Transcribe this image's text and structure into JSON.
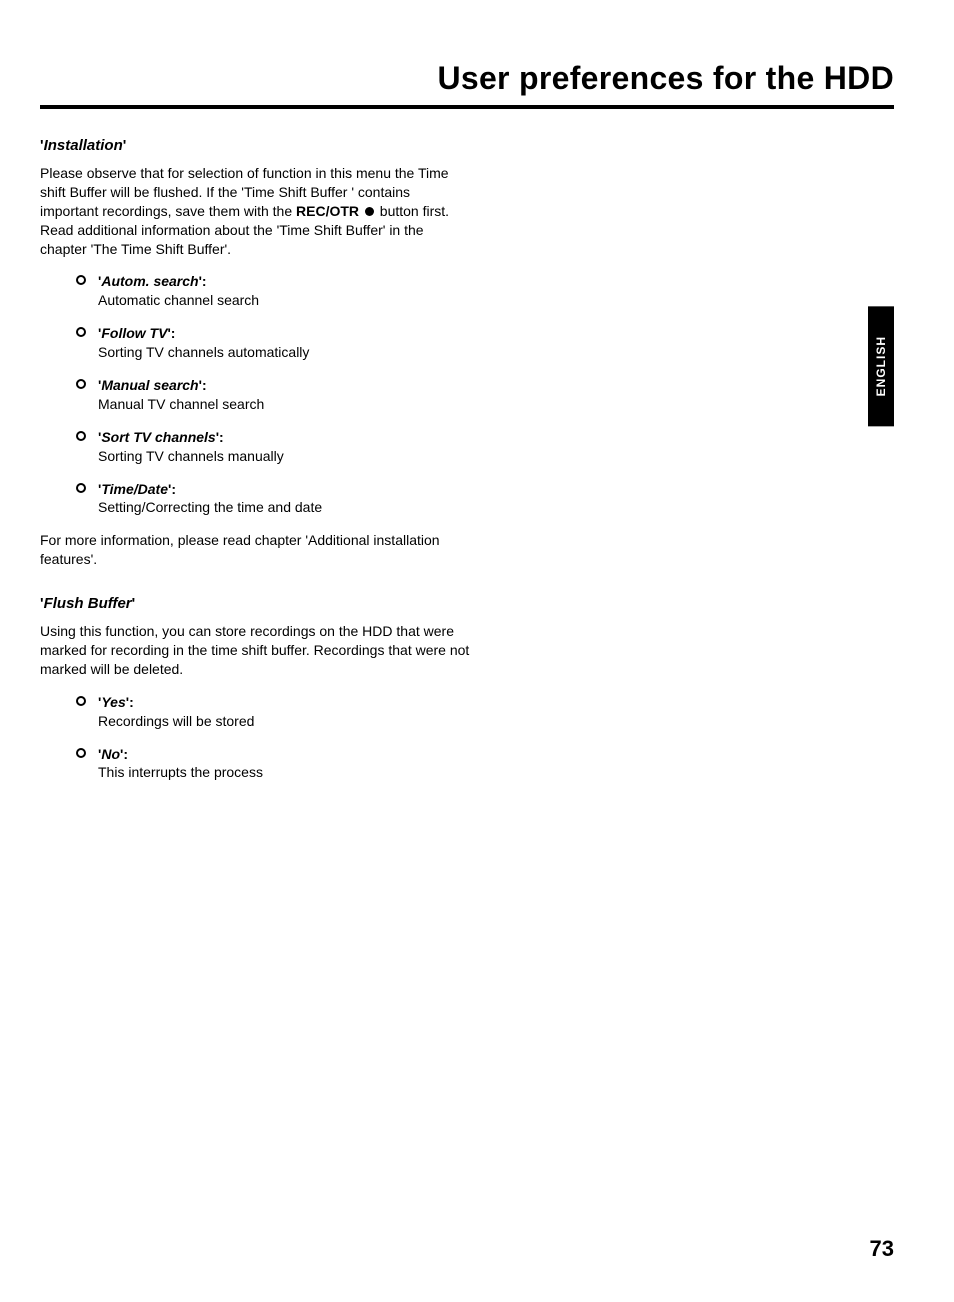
{
  "header": {
    "title": "User preferences for the HDD"
  },
  "sidebar": {
    "language": "ENGLISH"
  },
  "pageNumber": "73",
  "section1": {
    "heading_open": "'",
    "heading_name": "Installation",
    "heading_close": "'",
    "intro_pre": "Please observe that for selection of function in this menu the Time shift Buffer will be flushed. If the 'Time Shift Buffer ' contains important recordings, save them with the ",
    "intro_button": "REC/OTR",
    "intro_post": " button first. Read additional information about the 'Time Shift Buffer' in the chapter 'The Time Shift Buffer'.",
    "items": [
      {
        "label": "Autom. search",
        "desc": "Automatic channel search"
      },
      {
        "label": "Follow TV",
        "desc": "Sorting TV channels automatically"
      },
      {
        "label": "Manual search",
        "desc": "Manual TV channel search"
      },
      {
        "label": "Sort TV channels",
        "desc": "Sorting TV channels manually"
      },
      {
        "label": "Time/Date",
        "desc": "Setting/Correcting the time and date"
      }
    ],
    "outro": "For more information, please read chapter 'Additional installation features'."
  },
  "section2": {
    "heading_open": "'",
    "heading_name": "Flush Buffer",
    "heading_close": "'",
    "intro": "Using this function, you can store recordings on the HDD that were marked for recording in the time shift buffer. Recordings that were not marked will be deleted.",
    "items": [
      {
        "label": "Yes",
        "desc": "Recordings will be stored"
      },
      {
        "label": "No",
        "desc": "This interrupts the process"
      }
    ]
  }
}
